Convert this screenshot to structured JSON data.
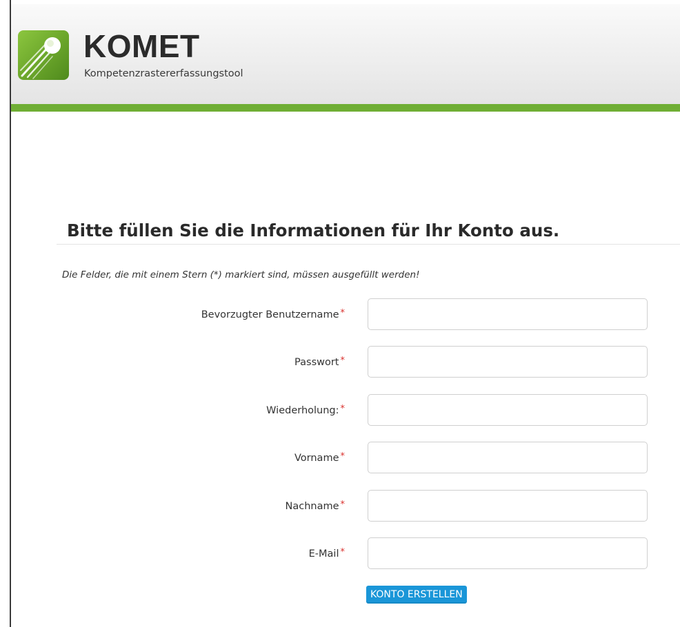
{
  "header": {
    "brand_title": "KOMET",
    "brand_subtitle": "Kompetenzrastererfassungstool",
    "logo_icon": "comet-logo-icon",
    "accent_color": "#6fae34"
  },
  "form": {
    "heading": "Bitte füllen Sie die Informationen für Ihr Konto aus.",
    "required_note": "Die Felder, die mit einem Stern (*) markiert sind, müssen ausgefüllt werden!",
    "required_marker": "*",
    "fields": [
      {
        "label": "Bevorzugter Benutzername",
        "value": "",
        "placeholder": ""
      },
      {
        "label": "Passwort",
        "value": "",
        "placeholder": ""
      },
      {
        "label": "Wiederholung:",
        "value": "",
        "placeholder": ""
      },
      {
        "label": "Vorname",
        "value": "",
        "placeholder": ""
      },
      {
        "label": "Nachname",
        "value": "",
        "placeholder": ""
      },
      {
        "label": "E-Mail",
        "value": "",
        "placeholder": ""
      }
    ],
    "submit_label": "KONTO ERSTELLEN",
    "submit_color": "#1a96d8",
    "required_color": "#d9302c"
  }
}
